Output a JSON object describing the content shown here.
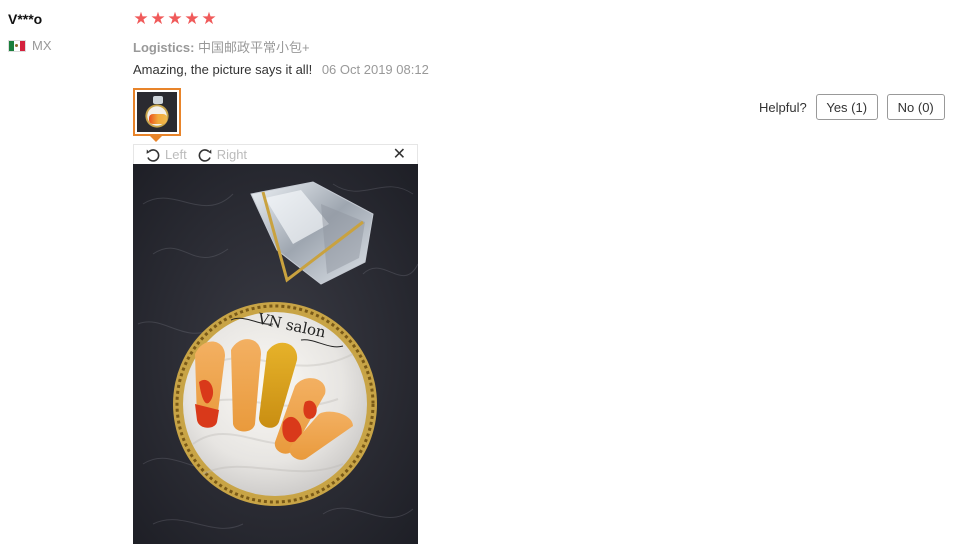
{
  "reviewer": {
    "name": "V***o",
    "country_code": "MX"
  },
  "review": {
    "rating": 5,
    "stars": [
      "★",
      "★",
      "★",
      "★",
      "★"
    ],
    "logistics_label": "Logistics:",
    "logistics_value": "中国邮政平常小包+",
    "text": "Amazing, the picture says it all!",
    "date": "06 Oct 2019 08:12"
  },
  "helpful": {
    "label": "Helpful?",
    "yes_label": "Yes (1)",
    "no_label": "No (0)"
  },
  "viewer": {
    "rotate_left_label": "Left",
    "rotate_right_label": "Right",
    "close_symbol": "✕"
  },
  "photo": {
    "logo_text": "VN salon"
  },
  "colors": {
    "star": "#f05a5a",
    "thumb_border": "#e8842a",
    "muted_text": "#999999"
  }
}
